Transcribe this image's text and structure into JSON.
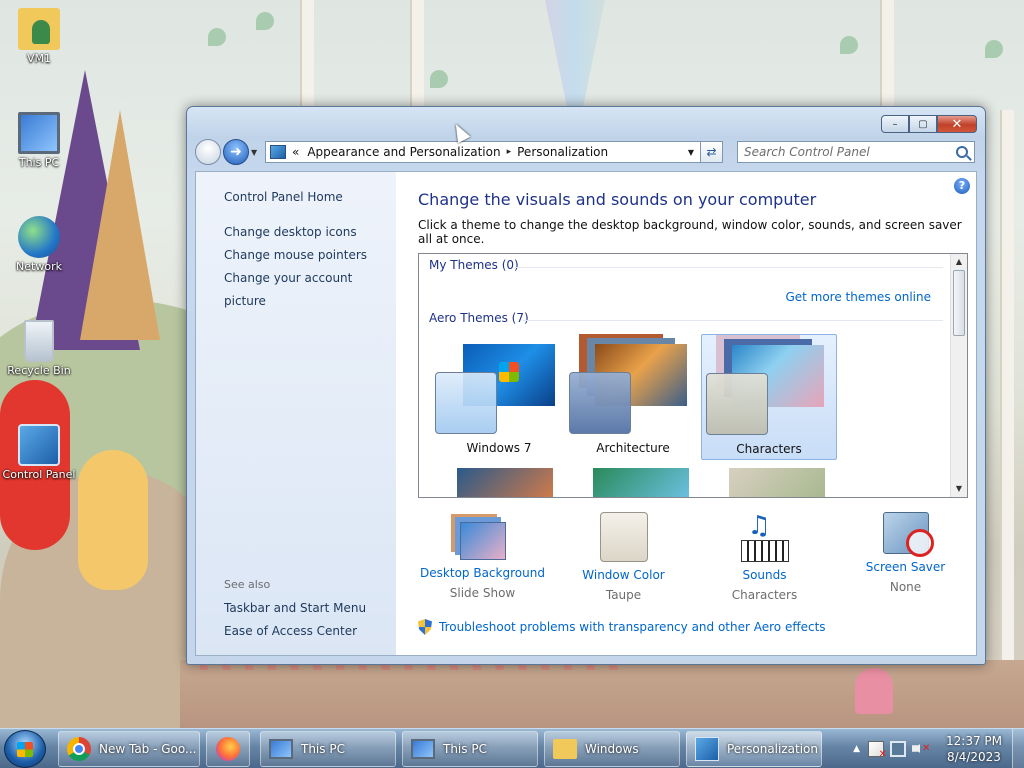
{
  "desktop": {
    "icons": [
      {
        "label": "VM1",
        "icon": "user-folder-icon"
      },
      {
        "label": "This PC",
        "icon": "computer-icon"
      },
      {
        "label": "Network",
        "icon": "network-icon"
      },
      {
        "label": "Recycle Bin",
        "icon": "recycle-bin-icon"
      },
      {
        "label": "Control Panel",
        "icon": "control-panel-icon"
      }
    ]
  },
  "window": {
    "controls": {
      "minimize": "–",
      "maximize": "▢",
      "close": "✕"
    },
    "address": {
      "prefix": "«",
      "crumbs": [
        "Appearance and Personalization",
        "Personalization"
      ],
      "crumb_separator": "▸"
    },
    "search": {
      "placeholder": "Search Control Panel"
    },
    "sidebar": {
      "home": "Control Panel Home",
      "links": [
        "Change desktop icons",
        "Change mouse pointers",
        "Change your account picture"
      ],
      "see_also_label": "See also",
      "see_also": [
        "Taskbar and Start Menu",
        "Ease of Access Center"
      ]
    },
    "main": {
      "help": "?",
      "title": "Change the visuals and sounds on your computer",
      "subtitle": "Click a theme to change the desktop background, window color, sounds, and screen saver all at once.",
      "my_themes_label": "My Themes (0)",
      "get_more_link": "Get more themes online",
      "aero_themes_label": "Aero Themes (7)",
      "themes": [
        {
          "name": "Windows 7",
          "selected": false
        },
        {
          "name": "Architecture",
          "selected": false
        },
        {
          "name": "Characters",
          "selected": true
        }
      ],
      "settings": [
        {
          "label": "Desktop Background",
          "value": "Slide Show",
          "icon": "desktop-background-icon"
        },
        {
          "label": "Window Color",
          "value": "Taupe",
          "icon": "window-color-icon"
        },
        {
          "label": "Sounds",
          "value": "Characters",
          "icon": "sounds-icon"
        },
        {
          "label": "Screen Saver",
          "value": "None",
          "icon": "screen-saver-icon"
        }
      ],
      "troubleshoot_link": "Troubleshoot problems with transparency and other Aero effects"
    }
  },
  "taskbar": {
    "buttons": [
      {
        "label": "New Tab - Goo...",
        "icon": "chrome-icon"
      },
      {
        "label": "",
        "icon": "firefox-icon"
      },
      {
        "label": "This PC",
        "icon": "computer-icon"
      },
      {
        "label": "This PC",
        "icon": "computer-icon"
      },
      {
        "label": "Windows",
        "icon": "folder-icon"
      },
      {
        "label": "Personalization",
        "icon": "control-panel-icon",
        "active": true
      }
    ],
    "tray_arrow": "▲",
    "clock": {
      "time": "12:37 PM",
      "date": "8/4/2023"
    }
  }
}
